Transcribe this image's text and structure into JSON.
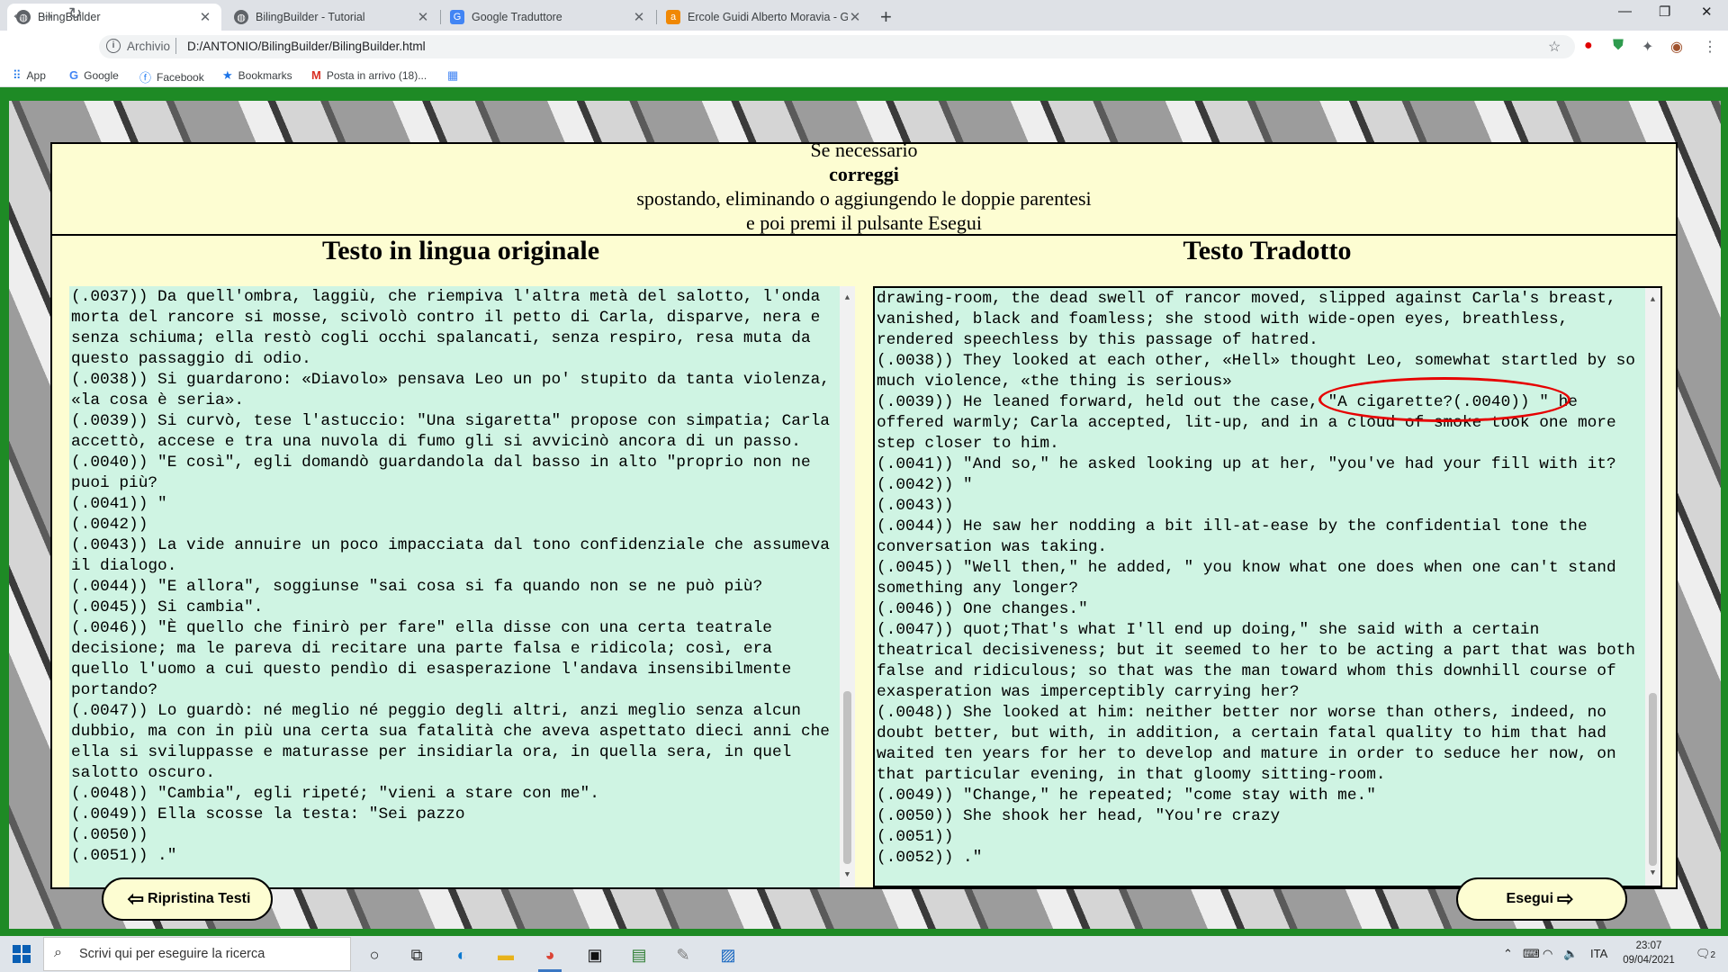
{
  "browser": {
    "tabs": [
      {
        "title": "BilingBuilder",
        "icon": "globe-icon",
        "active": true
      },
      {
        "title": "BilingBuilder - Tutorial",
        "icon": "globe-icon",
        "active": false
      },
      {
        "title": "Google Traduttore",
        "icon": "google-translate-icon",
        "active": false
      },
      {
        "title": "Ercole Guidi Alberto Moravia - Gi",
        "icon": "amazon-icon",
        "active": false
      }
    ],
    "url_scheme": "Archivio",
    "url_path": "D:/ANTONIO/BilingBuilder/BilingBuilder.html",
    "bookmarks": [
      {
        "label": "App",
        "icon": "apps-grid-icon"
      },
      {
        "label": "Google",
        "icon": "google-icon"
      },
      {
        "label": "Facebook",
        "icon": "facebook-icon"
      },
      {
        "label": "Bookmarks",
        "icon": "star-icon"
      },
      {
        "label": "Posta in arrivo (18)...",
        "icon": "gmail-icon"
      },
      {
        "label": "",
        "icon": "google-translate-icon"
      }
    ]
  },
  "instructions": {
    "line1": "Se necessario",
    "line2": "correggi",
    "line3": "spostando, eliminando o aggiungendo le doppie parentesi",
    "line4": "e poi premi il pulsante Esegui"
  },
  "left": {
    "heading": "Testo in lingua originale",
    "lines": [
      "(.0037)) Da quell'ombra, laggiù, che riempiva l'altra metà del salotto, l'onda",
      "morta del rancore si mosse, scivolò contro il petto di Carla, disparve, nera e",
      "senza schiuma; ella restò cogli occhi spalancati, senza respiro, resa muta da",
      "questo passaggio di odio.",
      "(.0038)) Si guardarono: «Diavolo» pensava Leo un po' stupito da tanta violenza,",
      "«la cosa è seria».",
      "(.0039)) Si curvò, tese l'astuccio: \"Una sigaretta\" propose con simpatia; Carla",
      "accettò, accese e tra una nuvola di fumo gli si avvicinò ancora di un passo.",
      "(.0040)) \"E così\", egli domandò guardandola dal basso in alto \"proprio non ne",
      "puoi più?",
      "(.0041)) \"",
      "(.0042))",
      "(.0043)) La vide annuire un poco impacciata dal tono confidenziale che assumeva",
      "il dialogo.",
      "(.0044)) \"E allora\", soggiunse \"sai cosa si fa quando non se ne può più?",
      "(.0045)) Si cambia\".",
      "(.0046)) \"È quello che finirò per fare\" ella disse con una certa teatrale",
      "decisione; ma le pareva di recitare una parte falsa e ridicola; così, era",
      "quello l'uomo a cui questo pendìo di esasperazione l'andava insensibilmente",
      "portando?",
      "(.0047)) Lo guardò: né meglio né peggio degli altri, anzi meglio senza alcun",
      "dubbio, ma con in più una certa sua fatalità che aveva aspettato dieci anni che",
      "ella si sviluppasse e maturasse per insidiarla ora, in quella sera, in quel",
      "salotto oscuro.",
      "(.0048)) \"Cambia\", egli ripeté; \"vieni a stare con me\".",
      "(.0049)) Ella scosse la testa: \"Sei pazzo",
      "(.0050))",
      "(.0051)) .\""
    ],
    "scroll_position": 0.85
  },
  "right": {
    "heading": "Testo Tradotto",
    "lines": [
      "drawing-room, the dead swell of rancor moved, slipped against Carla's breast,",
      "vanished, black and foamless; she stood with wide-open eyes, breathless,",
      "rendered speechless by this passage of hatred.",
      "(.0038)) They looked at each other, «Hell» thought Leo, somewhat startled by so",
      "much violence, «the thing is serious»",
      "(.0039)) He leaned forward, held out the case, \"A cigarette?(.0040)) \" he",
      "offered warmly; Carla accepted, lit-up, and in a cloud of smoke took one more",
      "step closer to him.",
      "(.0041)) \"And so,\" he asked looking up at her, \"you've had your fill with it?",
      "(.0042)) \"",
      "(.0043))",
      "(.0044)) He saw her nodding a bit ill-at-ease by the confidential tone the",
      "conversation was taking.",
      "(.0045)) \"Well then,\" he added, \" you know what one does when one can't stand",
      "something any longer?",
      "(.0046)) One changes.\"",
      "(.0047)) quot;That's what I'll end up doing,\" she said with a certain",
      "theatrical decisiveness; but it seemed to her to be acting a part that was both",
      "false and ridiculous; so that was the man toward whom this downhill course of",
      "exasperation was imperceptibly carrying her?",
      "(.0048)) She looked at him: neither better nor worse than others, indeed, no",
      "doubt better, but with, in addition, a certain fatal quality to him that had",
      "waited ten years for her to develop and mature in order to seduce her now, on",
      "that particular evening, in that gloomy sitting-room.",
      "(.0049)) \"Change,\" he repeated; \"come stay with me.\"",
      "(.0050)) She shook her head, \"You're crazy",
      "(.0051))",
      "(.0052)) .\""
    ],
    "scroll_position": 0.85
  },
  "buttons": {
    "reset": "Ripristina Testi",
    "execute": "Esegui"
  },
  "taskbar": {
    "search_placeholder": "Scrivi qui per eseguire la ricerca",
    "language": "ITA",
    "time": "23:07",
    "date": "09/04/2021",
    "notifications": "2"
  },
  "colors": {
    "page_green": "#1e8a25",
    "panel_yellow": "#fdfdd2",
    "textbox_mint": "#cff4e3",
    "highlight_red": "#e60000"
  }
}
